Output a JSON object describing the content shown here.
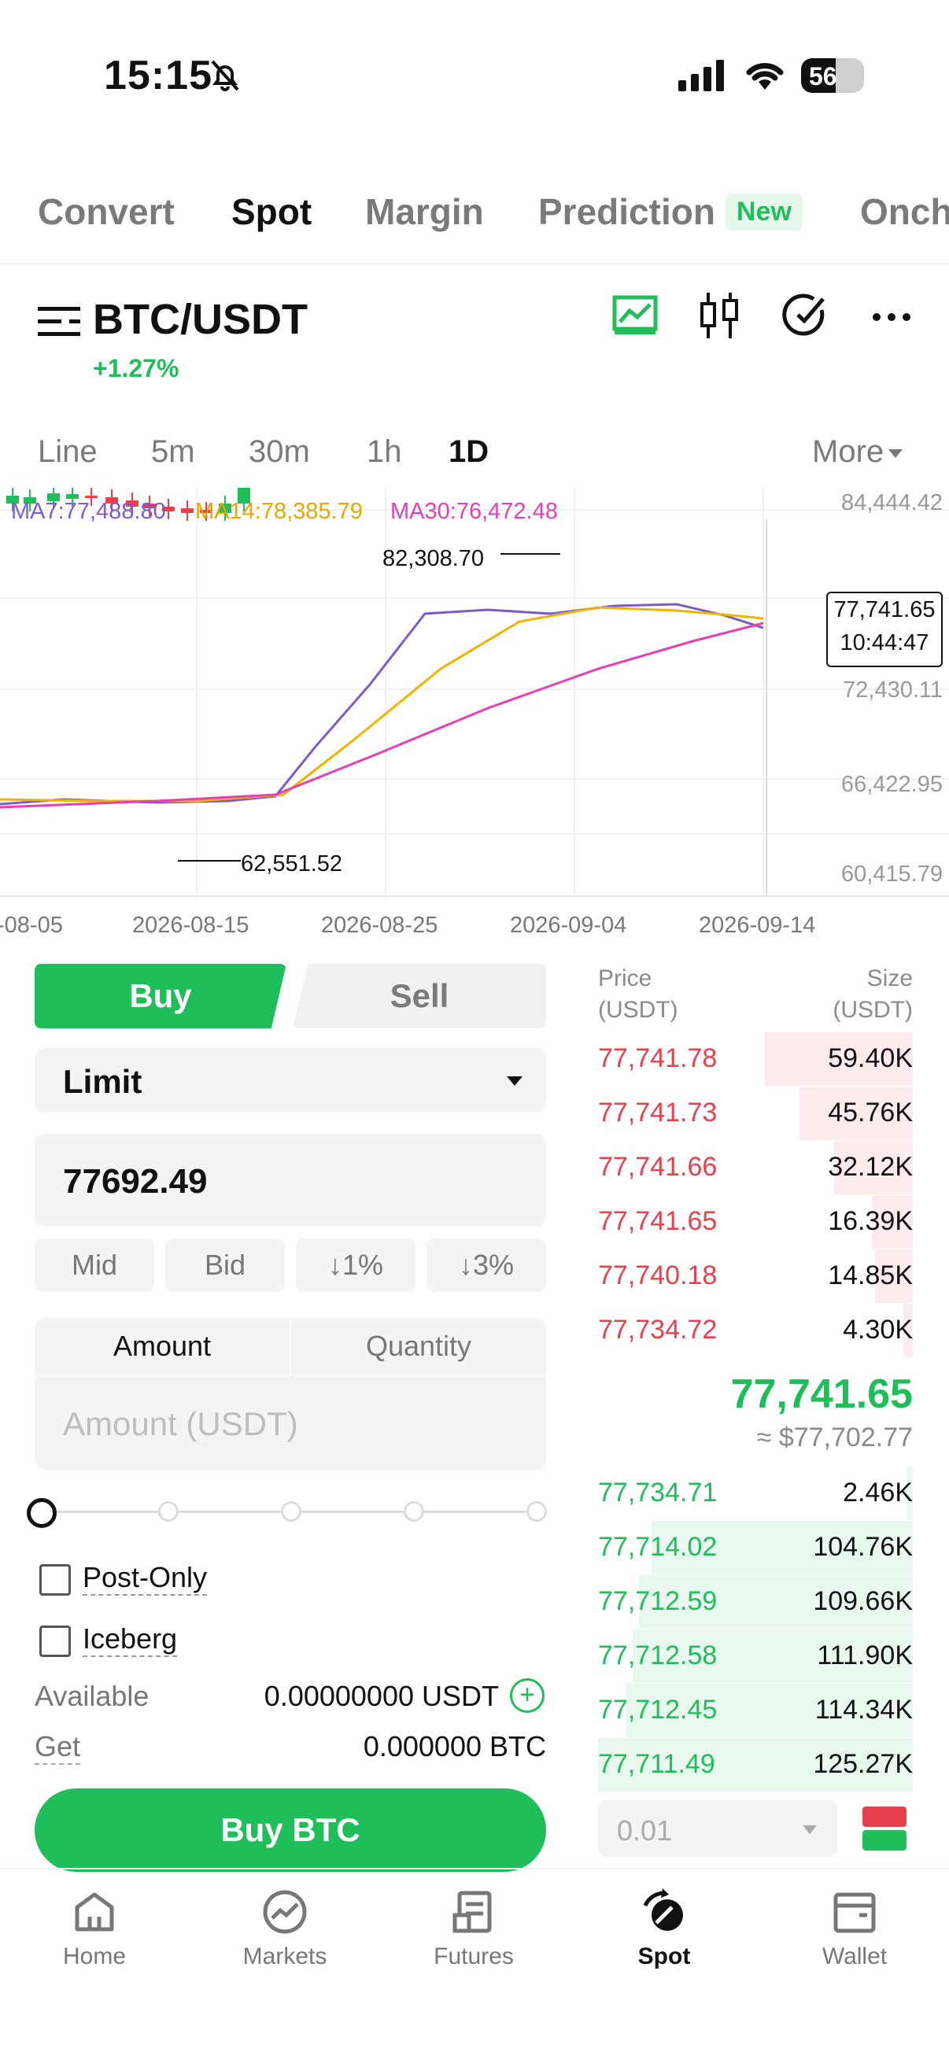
{
  "status_bar": {
    "time": "15:15",
    "battery": "56"
  },
  "top_tabs": [
    {
      "label": "Convert"
    },
    {
      "label": "Spot"
    },
    {
      "label": "Margin"
    },
    {
      "label": "Prediction"
    },
    {
      "label": "Onch"
    }
  ],
  "top_tab_badge": "New",
  "pair": {
    "symbol": "BTC/USDT",
    "change": "+1.27%"
  },
  "intervals": [
    "Line",
    "5m",
    "30m",
    "1h",
    "1D"
  ],
  "more_label": "More",
  "chart_data": {
    "type": "candlestick",
    "ma_labels": {
      "ma7": "MA7:77,488.80",
      "ma14": "MA14:78,385.79",
      "ma30": "MA30:76,472.48"
    },
    "colors": {
      "ma7": "#7c5cc9",
      "ma14": "#f0b400",
      "ma30": "#e63fb5",
      "up": "#1fbe5a",
      "down": "#e8404d"
    },
    "y_ticks": [
      "84,444.42",
      "72,430.11",
      "66,422.95",
      "60,415.79"
    ],
    "x_ticks": [
      "-08-05",
      "2026-08-15",
      "2026-08-25",
      "2026-09-04",
      "2026-09-14"
    ],
    "current_price": "77,741.65",
    "countdown": "10:44:47",
    "high_label": "82,308.70",
    "low_label": "62,551.52",
    "ylim": [
      60415.79,
      84444.42
    ]
  },
  "form": {
    "buy_label": "Buy",
    "sell_label": "Sell",
    "order_type": "Limit",
    "price": "77692.49",
    "quick": [
      "Mid",
      "Bid",
      "↓1%",
      "↓3%"
    ],
    "amount_tab": "Amount",
    "quantity_tab": "Quantity",
    "amount_placeholder": "Amount (USDT)",
    "post_only": "Post-Only",
    "iceberg": "Iceberg",
    "available_label": "Available",
    "available_value": "0.00000000 USDT",
    "get_label": "Get",
    "get_value": "0.000000 BTC",
    "submit": "Buy BTC"
  },
  "orderbook": {
    "price_header": "Price",
    "price_unit": "(USDT)",
    "size_header": "Size",
    "size_unit": "(USDT)",
    "asks": [
      {
        "price": "77,741.78",
        "size": "59.40K",
        "depth": 0.47
      },
      {
        "price": "77,741.73",
        "size": "45.76K",
        "depth": 0.36
      },
      {
        "price": "77,741.66",
        "size": "32.12K",
        "depth": 0.25
      },
      {
        "price": "77,741.65",
        "size": "16.39K",
        "depth": 0.13
      },
      {
        "price": "77,740.18",
        "size": "14.85K",
        "depth": 0.12
      },
      {
        "price": "77,734.72",
        "size": "4.30K",
        "depth": 0.03
      }
    ],
    "last_price": "77,741.65",
    "usd_price": "≈ $77,702.77",
    "bids": [
      {
        "price": "77,734.71",
        "size": "2.46K",
        "depth": 0.02
      },
      {
        "price": "77,714.02",
        "size": "104.76K",
        "depth": 0.83
      },
      {
        "price": "77,712.59",
        "size": "109.66K",
        "depth": 0.87
      },
      {
        "price": "77,712.58",
        "size": "111.90K",
        "depth": 0.89
      },
      {
        "price": "77,712.45",
        "size": "114.34K",
        "depth": 0.91
      },
      {
        "price": "77,711.49",
        "size": "125.27K",
        "depth": 1.0
      }
    ],
    "precision": "0.01"
  },
  "bottom_nav": [
    {
      "label": "Home",
      "icon": "home-icon"
    },
    {
      "label": "Markets",
      "icon": "markets-icon"
    },
    {
      "label": "Futures",
      "icon": "futures-icon"
    },
    {
      "label": "Spot",
      "icon": "spot-icon"
    },
    {
      "label": "Wallet",
      "icon": "wallet-icon"
    }
  ]
}
